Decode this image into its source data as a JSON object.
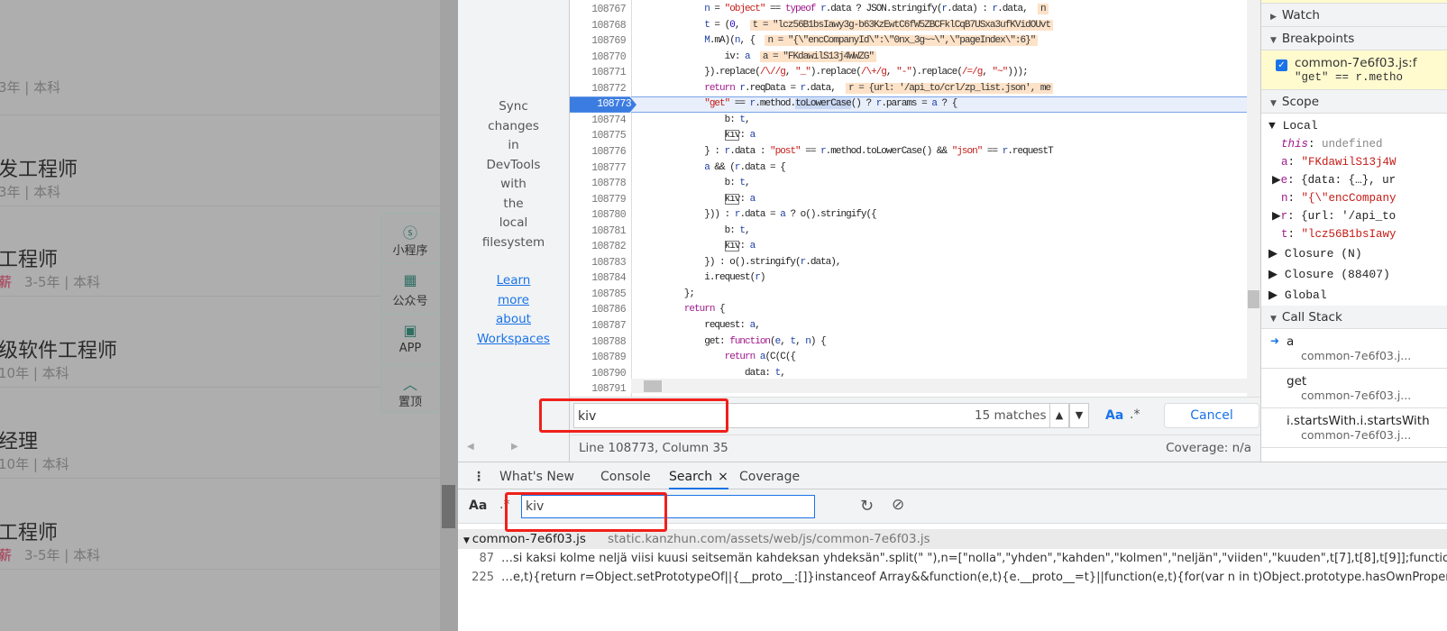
{
  "page": {
    "jobs": [
      {
        "title": "",
        "sub": "3年 | 本科",
        "tag": ""
      },
      {
        "title": "发工程师",
        "sub": "3年 | 本科",
        "tag": ""
      },
      {
        "title": "工程师",
        "sub": "3-5年 | 本科",
        "tag": "薪"
      },
      {
        "title": "级软件工程师",
        "sub": "10年 | 本科",
        "tag": ""
      },
      {
        "title": "经理",
        "sub": "10年 | 本科",
        "tag": ""
      },
      {
        "title": "工程师",
        "sub": "3-5年 | 本科",
        "tag": "薪"
      }
    ],
    "float_items": [
      {
        "label": "小程序",
        "icon": "mini-program-icon",
        "glyph": "ⓢ"
      },
      {
        "label": "公众号",
        "icon": "qr-code-icon",
        "glyph": "▦"
      },
      {
        "label": "APP",
        "icon": "app-phone-icon",
        "glyph": "▣"
      },
      {
        "label": "置顶",
        "icon": "chevron-up-icon",
        "glyph": "︿"
      }
    ]
  },
  "navigator": {
    "text": [
      "Sync",
      "changes",
      "in",
      "DevTools",
      "with",
      "the",
      "local",
      "filesystem"
    ],
    "link": [
      "Learn",
      "more",
      "about",
      "Workspaces"
    ]
  },
  "editor": {
    "current_line": 108773,
    "lines": [
      {
        "no": "108767",
        "tokens": [
          [
            "p",
            "            "
          ],
          [
            "v",
            "n"
          ],
          [
            "p",
            " = "
          ],
          [
            "s",
            "\"object\""
          ],
          [
            "p",
            " == "
          ],
          [
            "k",
            "typeof"
          ],
          [
            "p",
            " "
          ],
          [
            "v",
            "r"
          ],
          [
            "p",
            ".data ? JSON.stringify("
          ],
          [
            "v",
            "r"
          ],
          [
            "p",
            ".data) : "
          ],
          [
            "v",
            "r"
          ],
          [
            "p",
            ".data,  "
          ],
          [
            "i",
            "n"
          ]
        ]
      },
      {
        "no": "108768",
        "tokens": [
          [
            "p",
            "            "
          ],
          [
            "v",
            "t"
          ],
          [
            "p",
            " = ("
          ],
          [
            "n",
            "0"
          ],
          [
            "p",
            ",  "
          ],
          [
            "i",
            "t = \"lcz56B1bsIawy3g-b63KzEwtC6fW5ZBCFklCqB7USxa3ufKVidOUvt"
          ]
        ]
      },
      {
        "no": "108769",
        "tokens": [
          [
            "p",
            "            "
          ],
          [
            "v",
            "M"
          ],
          [
            "p",
            ".mA)("
          ],
          [
            "v",
            "n"
          ],
          [
            "p",
            ", {  "
          ],
          [
            "i",
            "n = \"{\\\"encCompanyId\\\":\\\"0nx_3g~~\\\",\\\"pageIndex\\\":6}\""
          ]
        ]
      },
      {
        "no": "108770",
        "tokens": [
          [
            "p",
            "                iv: "
          ],
          [
            "v",
            "a"
          ],
          [
            "p",
            "  "
          ],
          [
            "i",
            "a = \"FKdawilS13j4WWZG\""
          ]
        ]
      },
      {
        "no": "108771",
        "tokens": [
          [
            "p",
            "            }).replace("
          ],
          [
            "s",
            "/\\//g"
          ],
          [
            "p",
            ", "
          ],
          [
            "s",
            "\"_\""
          ],
          [
            "p",
            ").replace("
          ],
          [
            "s",
            "/\\+/g"
          ],
          [
            "p",
            ", "
          ],
          [
            "s",
            "\"-\""
          ],
          [
            "p",
            ").replace("
          ],
          [
            "s",
            "/=/g"
          ],
          [
            "p",
            ", "
          ],
          [
            "s",
            "\"~\""
          ],
          [
            "p",
            ")));"
          ]
        ]
      },
      {
        "no": "108772",
        "tokens": [
          [
            "p",
            "            "
          ],
          [
            "k",
            "return"
          ],
          [
            "p",
            " "
          ],
          [
            "v",
            "r"
          ],
          [
            "p",
            ".reqData = "
          ],
          [
            "v",
            "r"
          ],
          [
            "p",
            ".data,  "
          ],
          [
            "i",
            "r = {url: '/api_to/crl/zp_list.json', me"
          ]
        ]
      },
      {
        "no": "108773",
        "tokens": [
          [
            "p",
            "            "
          ],
          [
            "s",
            "\"get\""
          ],
          [
            "p",
            " == "
          ],
          [
            "v",
            "r"
          ],
          [
            "p",
            ".method."
          ],
          [
            "h",
            "toLowerCase"
          ],
          [
            "p",
            "() ? "
          ],
          [
            "v",
            "r"
          ],
          [
            "p",
            ".params = "
          ],
          [
            "v",
            "a"
          ],
          [
            "p",
            " ? {"
          ]
        ]
      },
      {
        "no": "108774",
        "tokens": [
          [
            "p",
            "                b: "
          ],
          [
            "v",
            "t"
          ],
          [
            "p",
            ","
          ]
        ]
      },
      {
        "no": "108775",
        "tokens": [
          [
            "p",
            "                "
          ],
          [
            "m",
            "kiv"
          ],
          [
            "p",
            ": "
          ],
          [
            "v",
            "a"
          ]
        ]
      },
      {
        "no": "108776",
        "tokens": [
          [
            "p",
            "            } : "
          ],
          [
            "v",
            "r"
          ],
          [
            "p",
            ".data : "
          ],
          [
            "s",
            "\"post\""
          ],
          [
            "p",
            " == "
          ],
          [
            "v",
            "r"
          ],
          [
            "p",
            ".method.toLowerCase() && "
          ],
          [
            "s",
            "\"json\""
          ],
          [
            "p",
            " == "
          ],
          [
            "v",
            "r"
          ],
          [
            "p",
            ".requestT"
          ]
        ]
      },
      {
        "no": "108777",
        "tokens": [
          [
            "p",
            "            "
          ],
          [
            "v",
            "a"
          ],
          [
            "p",
            " && ("
          ],
          [
            "v",
            "r"
          ],
          [
            "p",
            ".data = {"
          ]
        ]
      },
      {
        "no": "108778",
        "tokens": [
          [
            "p",
            "                b: "
          ],
          [
            "v",
            "t"
          ],
          [
            "p",
            ","
          ]
        ]
      },
      {
        "no": "108779",
        "tokens": [
          [
            "p",
            "                "
          ],
          [
            "m",
            "kiv"
          ],
          [
            "p",
            ": "
          ],
          [
            "v",
            "a"
          ]
        ]
      },
      {
        "no": "108780",
        "tokens": [
          [
            "p",
            "            })) : "
          ],
          [
            "v",
            "r"
          ],
          [
            "p",
            ".data = "
          ],
          [
            "v",
            "a"
          ],
          [
            "p",
            " ? o().stringify({"
          ]
        ]
      },
      {
        "no": "108781",
        "tokens": [
          [
            "p",
            "                b: "
          ],
          [
            "v",
            "t"
          ],
          [
            "p",
            ","
          ]
        ]
      },
      {
        "no": "108782",
        "tokens": [
          [
            "p",
            "                "
          ],
          [
            "m",
            "kiv"
          ],
          [
            "p",
            ": "
          ],
          [
            "v",
            "a"
          ]
        ]
      },
      {
        "no": "108783",
        "tokens": [
          [
            "p",
            "            }) : o().stringify("
          ],
          [
            "v",
            "r"
          ],
          [
            "p",
            ".data),"
          ]
        ]
      },
      {
        "no": "108784",
        "tokens": [
          [
            "p",
            "            i.request("
          ],
          [
            "v",
            "r"
          ],
          [
            "p",
            ")"
          ]
        ]
      },
      {
        "no": "108785",
        "tokens": [
          [
            "p",
            "        };"
          ]
        ]
      },
      {
        "no": "108786",
        "tokens": [
          [
            "p",
            "        "
          ],
          [
            "k",
            "return"
          ],
          [
            "p",
            " {"
          ]
        ]
      },
      {
        "no": "108787",
        "tokens": [
          [
            "p",
            "            request: "
          ],
          [
            "v",
            "a"
          ],
          [
            "p",
            ","
          ]
        ]
      },
      {
        "no": "108788",
        "tokens": [
          [
            "p",
            "            get: "
          ],
          [
            "k",
            "function"
          ],
          [
            "p",
            "("
          ],
          [
            "v",
            "e"
          ],
          [
            "p",
            ", "
          ],
          [
            "v",
            "t"
          ],
          [
            "p",
            ", "
          ],
          [
            "v",
            "n"
          ],
          [
            "p",
            ") {"
          ]
        ]
      },
      {
        "no": "108789",
        "tokens": [
          [
            "p",
            "                "
          ],
          [
            "k",
            "return"
          ],
          [
            "p",
            " "
          ],
          [
            "v",
            "a"
          ],
          [
            "p",
            "(C(C({"
          ]
        ]
      },
      {
        "no": "108790",
        "tokens": [
          [
            "p",
            "                    data: "
          ],
          [
            "v",
            "t"
          ],
          [
            "p",
            ","
          ]
        ]
      },
      {
        "no": "108791",
        "tokens": []
      }
    ]
  },
  "find": {
    "value": "kiv",
    "matches": "15 matches",
    "prev": "▲",
    "next": "▼",
    "case_label": "Aa",
    "regex_label": ".*",
    "cancel": "Cancel"
  },
  "status": {
    "position": "Line 108773, Column 35",
    "coverage": "Coverage: n/a"
  },
  "sidebar": {
    "watch": "Watch",
    "breakpoints": "Breakpoints",
    "breakpoint": {
      "file": "common-7e6f03.js:f",
      "code": "\"get\" == r.metho",
      "checked": true
    },
    "scope": "Scope",
    "local": "Local",
    "locals": [
      {
        "name": "this",
        "value": "undefined",
        "expandable": false
      },
      {
        "name": "a",
        "value": "\"FKdawilS13j4W",
        "expandable": false
      },
      {
        "name": "e",
        "value": "{data: {…}, ur",
        "expandable": true
      },
      {
        "name": "n",
        "value": "\"{\\\"encCompany",
        "expandable": false
      },
      {
        "name": "r",
        "value": "{url: '/api_to",
        "expandable": true
      },
      {
        "name": "t",
        "value": "\"lcz56B1bsIawy",
        "expandable": false
      }
    ],
    "closures": [
      "Closure (N)",
      "Closure (88407)",
      "Global"
    ],
    "call_stack": "Call Stack",
    "frames": [
      {
        "fn": "a",
        "file": "common-7e6f03.j...",
        "current": true
      },
      {
        "fn": "get",
        "file": "common-7e6f03.j...",
        "current": false
      },
      {
        "fn": "i.startsWith.i.startsWith",
        "file": "common-7e6f03.j...",
        "current": false
      }
    ]
  },
  "drawer": {
    "tabs": [
      "What's New",
      "Console",
      "Search",
      "Coverage"
    ],
    "active_tab": "Search",
    "close": "×",
    "search": {
      "case_label": "Aa",
      "regex_label": ".*",
      "value": "kiv"
    },
    "result_file": "common-7e6f03.js",
    "result_url": "static.kanzhun.com/assets/web/js/common-7e6f03.js",
    "results": [
      {
        "line": "87",
        "text": "…si kaksi kolme neljä viisi kuusi seitsemän kahdeksan yhdeksän\".split(\" \"),n=[\"nolla\",\"yhden\",\"kahden\",\"kolmen\",\"neljän\",\"viiden\",\"kuuden\",t[7],t[8],t[9]];function"
      },
      {
        "line": "225",
        "text": "…e,t){return r=Object.setPrototypeOf||{__proto__:[]}instanceof Array&&function(e,t){e.__proto__=t}||function(e,t){for(var n in t)Object.prototype.hasOwnProper"
      }
    ]
  },
  "colors": {
    "accent": "#1a73e8",
    "annotation": "#f0201a",
    "breakpoint_bg": "#fffbcf",
    "inline_value_bg": "#fde2c8"
  }
}
